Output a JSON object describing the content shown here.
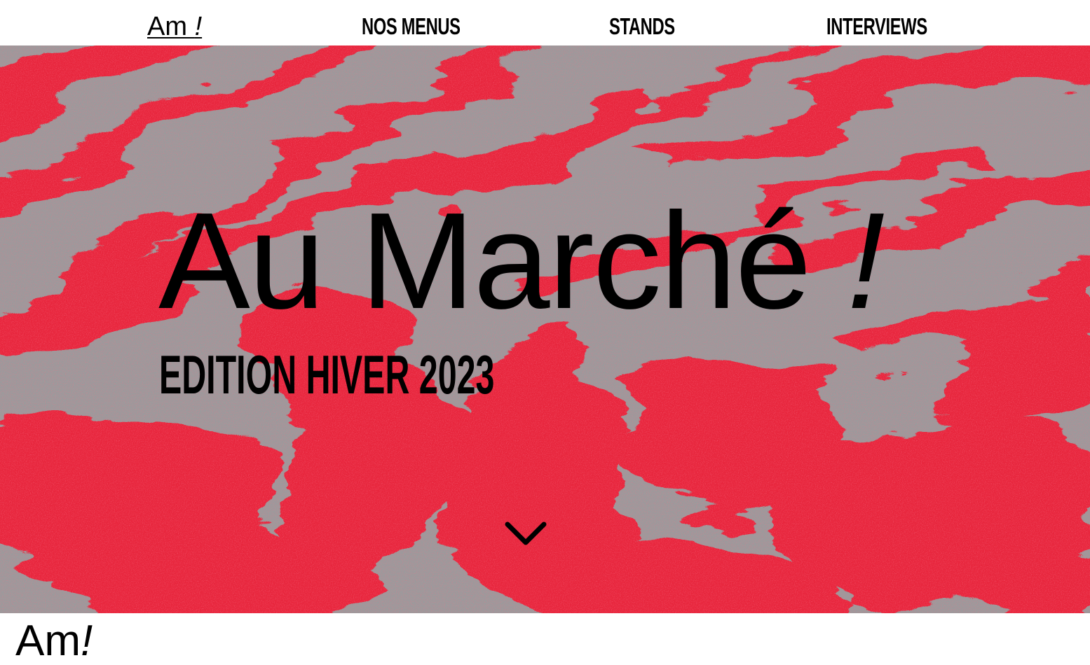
{
  "nav": {
    "logo_text": "Am",
    "logo_bang": "!",
    "links": [
      {
        "label": "NOS MENUS"
      },
      {
        "label": "STANDS"
      },
      {
        "label": "INTERVIEWS"
      }
    ]
  },
  "hero": {
    "title": "Au Marché",
    "title_bang": "!",
    "subtitle": "EDITION HIVER 2023",
    "scroll_icon": "chevron-down-icon"
  },
  "footer": {
    "logo_text": "Am",
    "logo_bang": "!"
  },
  "colors": {
    "marble_red": "#e8283e",
    "marble_grey": "#9b9a9c",
    "text": "#000000",
    "background": "#ffffff"
  }
}
